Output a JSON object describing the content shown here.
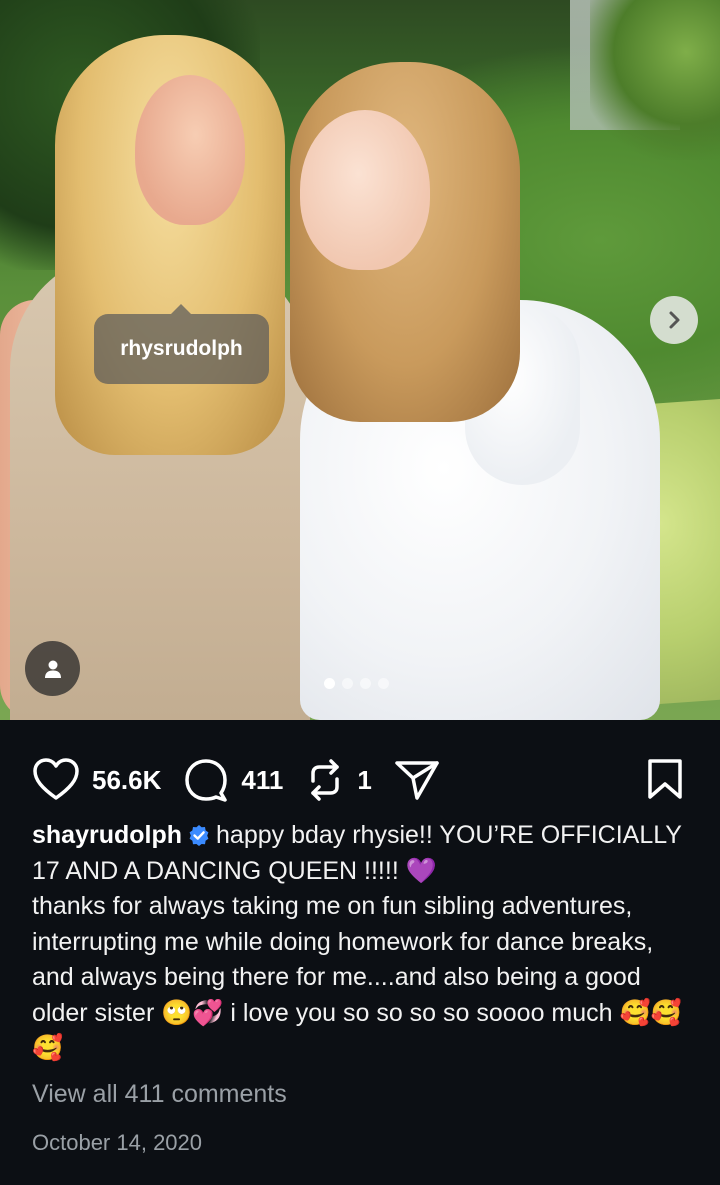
{
  "photo": {
    "tagged_user": "rhysrudolph",
    "carousel": {
      "total": 4,
      "active_index": 0
    }
  },
  "actions": {
    "likes": "56.6K",
    "comments": "411",
    "reposts": "1"
  },
  "caption": {
    "username": "shayrudolph",
    "verified": true,
    "text_line1": "happy bday rhysie!! YOU’RE OFFICIALLY 17 AND A DANCING QUEEN !!!!! 💜",
    "text_line2": "thanks for always taking me on fun sibling adventures, interrupting me while doing homework for dance breaks, and always being there for me....and also being a good older sister 🙄💞 i love you so so so so soooo much 🥰🥰🥰"
  },
  "view_comments_label": "View all 411 comments",
  "date": "October 14, 2020",
  "colors": {
    "background": "#0c0f14",
    "verified_blue": "#3b8bff",
    "muted_text": "#9aa0a6"
  },
  "icons": {
    "like": "heart-outline-icon",
    "comment": "speech-bubble-icon",
    "repost": "repost-arrows-icon",
    "share": "paper-plane-icon",
    "save": "bookmark-icon",
    "tag": "person-icon",
    "next": "chevron-right-icon",
    "verified": "verified-badge-icon"
  }
}
